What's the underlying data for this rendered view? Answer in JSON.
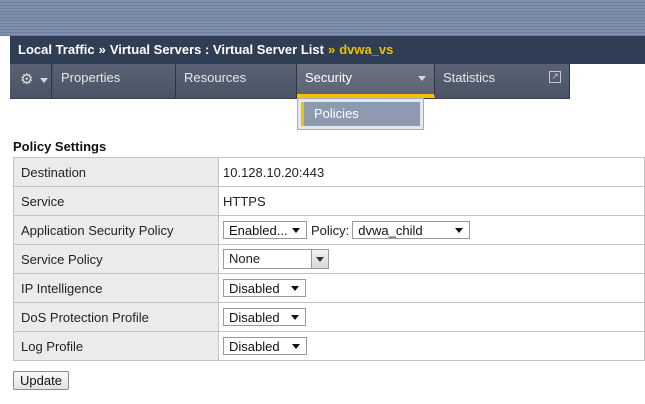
{
  "breadcrumb": {
    "part1": "Local Traffic",
    "sep1": "»",
    "part2": "Virtual Servers : Virtual Server List",
    "sep2": "»",
    "current": "dvwa_vs"
  },
  "tabs": {
    "gear_icon": "gear-icon",
    "items": [
      {
        "label": "Properties"
      },
      {
        "label": "Resources"
      },
      {
        "label": "Security"
      },
      {
        "label": "Statistics"
      }
    ],
    "active": "Security"
  },
  "security_menu": {
    "items": [
      {
        "label": "Policies"
      }
    ]
  },
  "section": {
    "title": "Policy Settings"
  },
  "settings": {
    "destination": {
      "label": "Destination",
      "value": "10.128.10.20:443"
    },
    "service": {
      "label": "Service",
      "value": "HTTPS"
    },
    "asp": {
      "label": "Application Security Policy",
      "state": "Enabled...",
      "policy_label": "Policy:",
      "policy": "dvwa_child"
    },
    "service_policy": {
      "label": "Service Policy",
      "value": "None"
    },
    "ip_intelligence": {
      "label": "IP Intelligence",
      "value": "Disabled"
    },
    "dos_profile": {
      "label": "DoS Protection Profile",
      "value": "Disabled"
    },
    "log_profile": {
      "label": "Log Profile",
      "value": "Disabled"
    }
  },
  "actions": {
    "update_label": "Update"
  },
  "colors": {
    "breadcrumb_bg": "#2f3d55",
    "accent_gold": "#f5c000",
    "tab_bg": "#4b5465",
    "label_cell_bg": "#ebebeb"
  }
}
